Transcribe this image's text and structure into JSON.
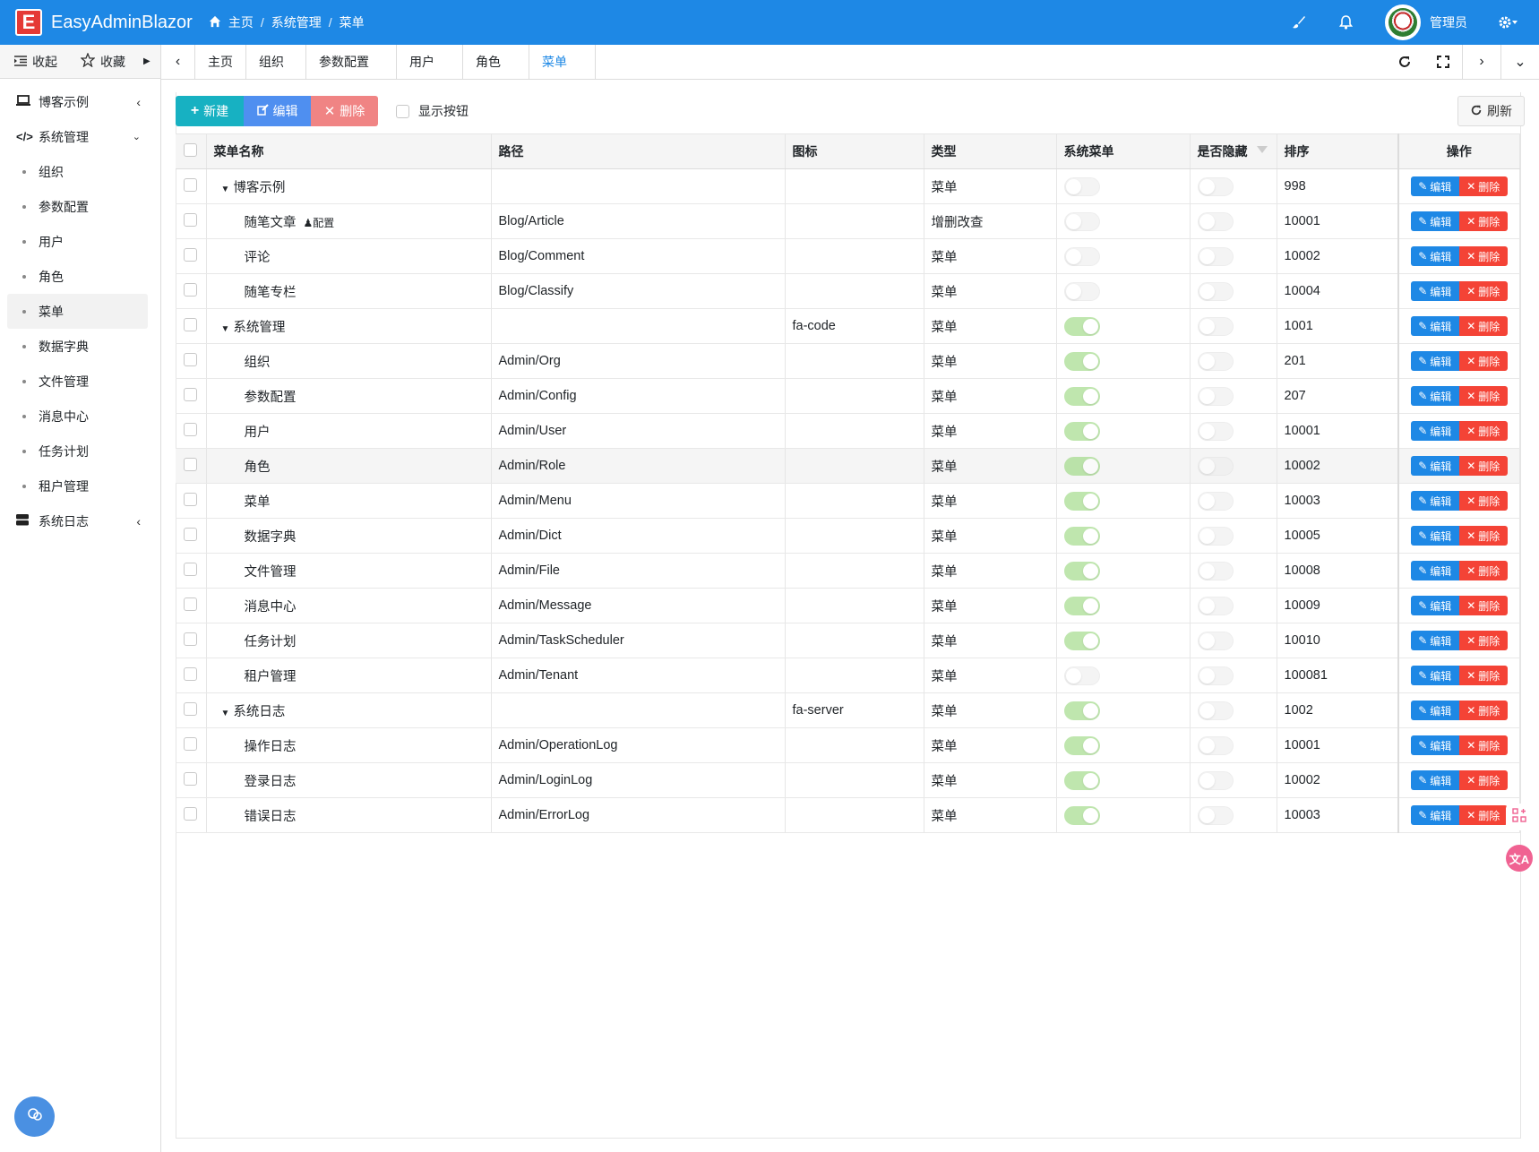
{
  "app": {
    "logo_letter": "E",
    "title": "EasyAdminBlazor"
  },
  "breadcrumb": [
    "主页",
    "系统管理",
    "菜单"
  ],
  "user": {
    "name": "管理员"
  },
  "sidebar": {
    "collapse_label": "收起",
    "favorites_label": "收藏",
    "groups": [
      {
        "label": "博客示例",
        "icon": "laptop-icon",
        "expanded": false
      },
      {
        "label": "系统管理",
        "icon": "code-icon",
        "expanded": true,
        "items": [
          "组织",
          "参数配置",
          "用户",
          "角色",
          "菜单",
          "数据字典",
          "文件管理",
          "消息中心",
          "任务计划",
          "租户管理"
        ],
        "active": "菜单"
      },
      {
        "label": "系统日志",
        "icon": "server-icon",
        "expanded": false
      }
    ]
  },
  "tabs": [
    "主页",
    "组织",
    "参数配置",
    "用户",
    "角色",
    "菜单"
  ],
  "active_tab": "菜单",
  "toolbar": {
    "new_label": "新建",
    "edit_label": "编辑",
    "delete_label": "删除",
    "show_buttons_label": "显示按钮",
    "refresh_label": "刷新"
  },
  "table": {
    "columns": [
      "菜单名称",
      "路径",
      "图标",
      "类型",
      "系统菜单",
      "是否隐藏",
      "排序",
      "操作"
    ],
    "row_edit_label": "编辑",
    "row_delete_label": "删除",
    "rows": [
      {
        "name": "博客示例",
        "level": 0,
        "path": "",
        "icon": "",
        "type": "菜单",
        "system": false,
        "hidden": false,
        "sort": "998"
      },
      {
        "name": "随笔文章",
        "tag": "配置",
        "level": 1,
        "path": "Blog/Article",
        "icon": "",
        "type": "增删改查",
        "system": false,
        "hidden": false,
        "sort": "10001"
      },
      {
        "name": "评论",
        "level": 1,
        "path": "Blog/Comment",
        "icon": "",
        "type": "菜单",
        "system": false,
        "hidden": false,
        "sort": "10002"
      },
      {
        "name": "随笔专栏",
        "level": 1,
        "path": "Blog/Classify",
        "icon": "",
        "type": "菜单",
        "system": false,
        "hidden": false,
        "sort": "10004"
      },
      {
        "name": "系统管理",
        "level": 0,
        "path": "",
        "icon": "fa-code",
        "type": "菜单",
        "system": true,
        "hidden": false,
        "sort": "1001"
      },
      {
        "name": "组织",
        "level": 1,
        "path": "Admin/Org",
        "icon": "",
        "type": "菜单",
        "system": true,
        "hidden": false,
        "sort": "201"
      },
      {
        "name": "参数配置",
        "level": 1,
        "path": "Admin/Config",
        "icon": "",
        "type": "菜单",
        "system": true,
        "hidden": false,
        "sort": "207"
      },
      {
        "name": "用户",
        "level": 1,
        "path": "Admin/User",
        "icon": "",
        "type": "菜单",
        "system": true,
        "hidden": false,
        "sort": "10001"
      },
      {
        "name": "角色",
        "level": 1,
        "path": "Admin/Role",
        "icon": "",
        "type": "菜单",
        "system": true,
        "hidden": false,
        "sort": "10002",
        "highlight": true
      },
      {
        "name": "菜单",
        "level": 1,
        "path": "Admin/Menu",
        "icon": "",
        "type": "菜单",
        "system": true,
        "hidden": false,
        "sort": "10003"
      },
      {
        "name": "数据字典",
        "level": 1,
        "path": "Admin/Dict",
        "icon": "",
        "type": "菜单",
        "system": true,
        "hidden": false,
        "sort": "10005"
      },
      {
        "name": "文件管理",
        "level": 1,
        "path": "Admin/File",
        "icon": "",
        "type": "菜单",
        "system": true,
        "hidden": false,
        "sort": "10008"
      },
      {
        "name": "消息中心",
        "level": 1,
        "path": "Admin/Message",
        "icon": "",
        "type": "菜单",
        "system": true,
        "hidden": false,
        "sort": "10009"
      },
      {
        "name": "任务计划",
        "level": 1,
        "path": "Admin/TaskScheduler",
        "icon": "",
        "type": "菜单",
        "system": true,
        "hidden": false,
        "sort": "10010"
      },
      {
        "name": "租户管理",
        "level": 1,
        "path": "Admin/Tenant",
        "icon": "",
        "type": "菜单",
        "system": false,
        "hidden": false,
        "sort": "100081"
      },
      {
        "name": "系统日志",
        "level": 0,
        "path": "",
        "icon": "fa-server",
        "type": "菜单",
        "system": true,
        "hidden": false,
        "sort": "1002"
      },
      {
        "name": "操作日志",
        "level": 1,
        "path": "Admin/OperationLog",
        "icon": "",
        "type": "菜单",
        "system": true,
        "hidden": false,
        "sort": "10001"
      },
      {
        "name": "登录日志",
        "level": 1,
        "path": "Admin/LoginLog",
        "icon": "",
        "type": "菜单",
        "system": true,
        "hidden": false,
        "sort": "10002"
      },
      {
        "name": "错误日志",
        "level": 1,
        "path": "Admin/ErrorLog",
        "icon": "",
        "type": "菜单",
        "system": true,
        "hidden": false,
        "sort": "10003"
      }
    ]
  },
  "colors": {
    "header": "#1E88E5",
    "new": "#17b1c2",
    "edit": "#4f8ff0",
    "delete": "#f08484",
    "switch_on": "#8bd36c",
    "row_edit": "#1E88E5",
    "row_delete": "#f44336"
  }
}
